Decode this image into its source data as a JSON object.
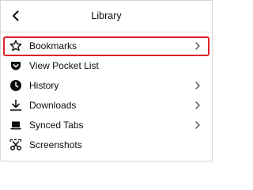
{
  "header": {
    "title": "Library"
  },
  "menu": {
    "items": [
      {
        "label": "Bookmarks",
        "icon": "star-icon",
        "has_submenu": true,
        "highlighted": true
      },
      {
        "label": "View Pocket List",
        "icon": "pocket-icon",
        "has_submenu": false
      },
      {
        "label": "History",
        "icon": "history-clock-icon",
        "has_submenu": true
      },
      {
        "label": "Downloads",
        "icon": "download-arrow-icon",
        "has_submenu": true
      },
      {
        "label": "Synced Tabs",
        "icon": "synced-tabs-icon",
        "has_submenu": true
      },
      {
        "label": "Screenshots",
        "icon": "scissors-icon",
        "has_submenu": false
      }
    ]
  },
  "colors": {
    "highlight_outline": "#e0202b",
    "text": "#0c0c0d",
    "separator": "#e0e0e2"
  }
}
